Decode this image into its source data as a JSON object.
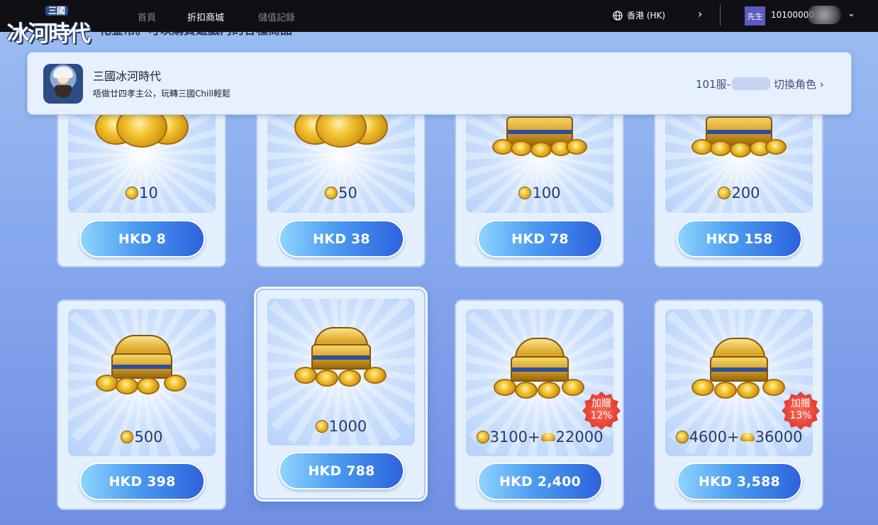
{
  "logo": {
    "small": "三國",
    "big": "冰河時代"
  },
  "nav": [
    {
      "label": "首頁",
      "active": false
    },
    {
      "label": "折扣商城",
      "active": true
    },
    {
      "label": "儲值記錄",
      "active": false
    }
  ],
  "region": {
    "label": "香港 (HK)"
  },
  "user": {
    "title": "先生",
    "id": "10100000"
  },
  "notice_partial": "化金幣。可以購買遊戲內的各種商品",
  "game": {
    "title": "三國冰河時代",
    "subtitle": "唔做廿四孝主公，玩轉三國Chill輕鬆",
    "server": "101服-",
    "switch_label": "切換角色 ›"
  },
  "products": [
    {
      "amount": "10",
      "price": "HKD 8"
    },
    {
      "amount": "50",
      "price": "HKD 38"
    },
    {
      "amount": "100",
      "price": "HKD 78"
    },
    {
      "amount": "200",
      "price": "HKD 158"
    },
    {
      "amount": "500",
      "price": "HKD 398"
    },
    {
      "amount": "1000",
      "price": "HKD 788",
      "featured": true
    },
    {
      "amount": "3100",
      "bonus_amount": "22000",
      "price": "HKD 2,400",
      "bonus_badge": [
        "加贈",
        "12%"
      ]
    },
    {
      "amount": "4600",
      "bonus_amount": "36000",
      "price": "HKD 3,588",
      "bonus_badge": [
        "加贈",
        "13%"
      ]
    }
  ],
  "colors": {
    "topbar": "#101014",
    "accent": "#2e62dd",
    "badge": "#e23b30"
  },
  "icons": [
    "globe-icon",
    "chevron-right-icon",
    "chevron-down-icon",
    "gold-coin-icon",
    "gold-ingot-icon"
  ]
}
